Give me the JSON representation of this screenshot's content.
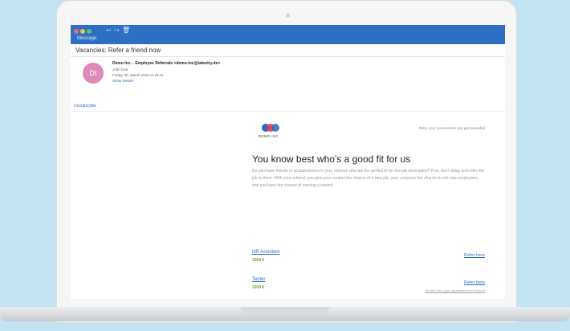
{
  "window": {
    "tab_label": "Message"
  },
  "email": {
    "subject": "Vacancies: Refer a friend now",
    "avatar_initials": "DI",
    "sender": "Demo Inc. - Employee Referrals <demo-inc@talentry.de>",
    "to": "John Doe",
    "date": "Friday, 30. March 2018 at 18:41",
    "show_details": "Show Details",
    "unsubscribe": "Unsubscribe"
  },
  "body": {
    "logo_text": "DEMO INC.",
    "tagline": "Refer your connections and get rewarded",
    "headline": "You know best who's a good fit for us",
    "intro": "Do you have friends or acquaintances in your network who are the perfect fit for this job description? If so, don't delay and refer the job to them. With your referral, you give your contact the chance of a new job, your company the chance to win new employees, and you have the chance of earning a reward.",
    "jobs": [
      {
        "title": "HR Assistant",
        "bonus": "1000 €",
        "action": "Refer here"
      },
      {
        "title": "Tester",
        "bonus": "1000 €",
        "action": "Refer here"
      }
    ],
    "footer": "All jobs from your department and beyond"
  },
  "colors": {
    "accent": "#2c6fc5",
    "avatar": "#de8ab8",
    "bonus": "#6ba42e",
    "link": "#2a6cc6"
  }
}
